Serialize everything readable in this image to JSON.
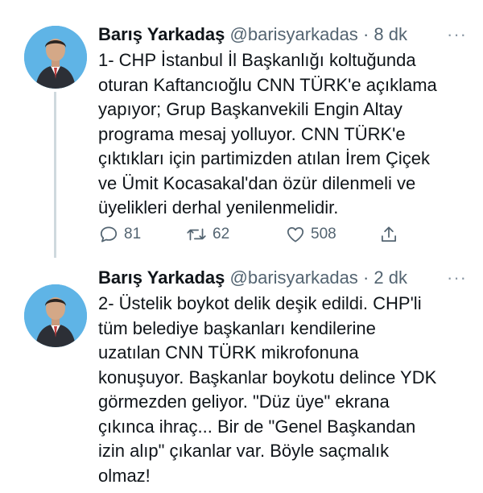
{
  "tweets": [
    {
      "author_name": "Barış Yarkadaş",
      "handle": "@barisyarkadas",
      "separator": "·",
      "time": "8 dk",
      "more": "···",
      "text": "1- CHP İstanbul İl Başkanlığı koltuğunda\noturan Kaftancıoğlu CNN TÜRK'e açıklama\nyapıyor; Grup Başkanvekili Engin Altay\nprograma mesaj yolluyor. CNN TÜRK'e\nçıktıkları için partimizden atılan İrem Çiçek\nve Ümit Kocasakal'dan özür dilenmeli ve\nüyelikleri derhal yenilenmelidir.",
      "replies": "81",
      "retweets": "62",
      "likes": "508"
    },
    {
      "author_name": "Barış Yarkadaş",
      "handle": "@barisyarkadas",
      "separator": "·",
      "time": "2 dk",
      "more": "···",
      "text": "2- Üstelik boykot delik deşik edildi. CHP'li\ntüm belediye başkanları kendilerine\nuzatılan CNN TÜRK mikrofonuna\nkonuşuyor. Başkanlar boykotu delince YDK\ngörmezden geliyor. \"Düz üye\" ekrana\nçıkınca ihraç... Bir de \"Genel Başkandan\nizin alıp\" çıkanlar var. Böyle saçmalık\nolmaz!"
    }
  ],
  "icons": {
    "reply": "reply-icon",
    "retweet": "retweet-icon",
    "like": "heart-icon",
    "share": "share-icon"
  },
  "colors": {
    "text": "#0f1419",
    "secondary": "#536471",
    "thread_line": "#cfd9de",
    "avatar_bg": "#5fb4e6"
  }
}
